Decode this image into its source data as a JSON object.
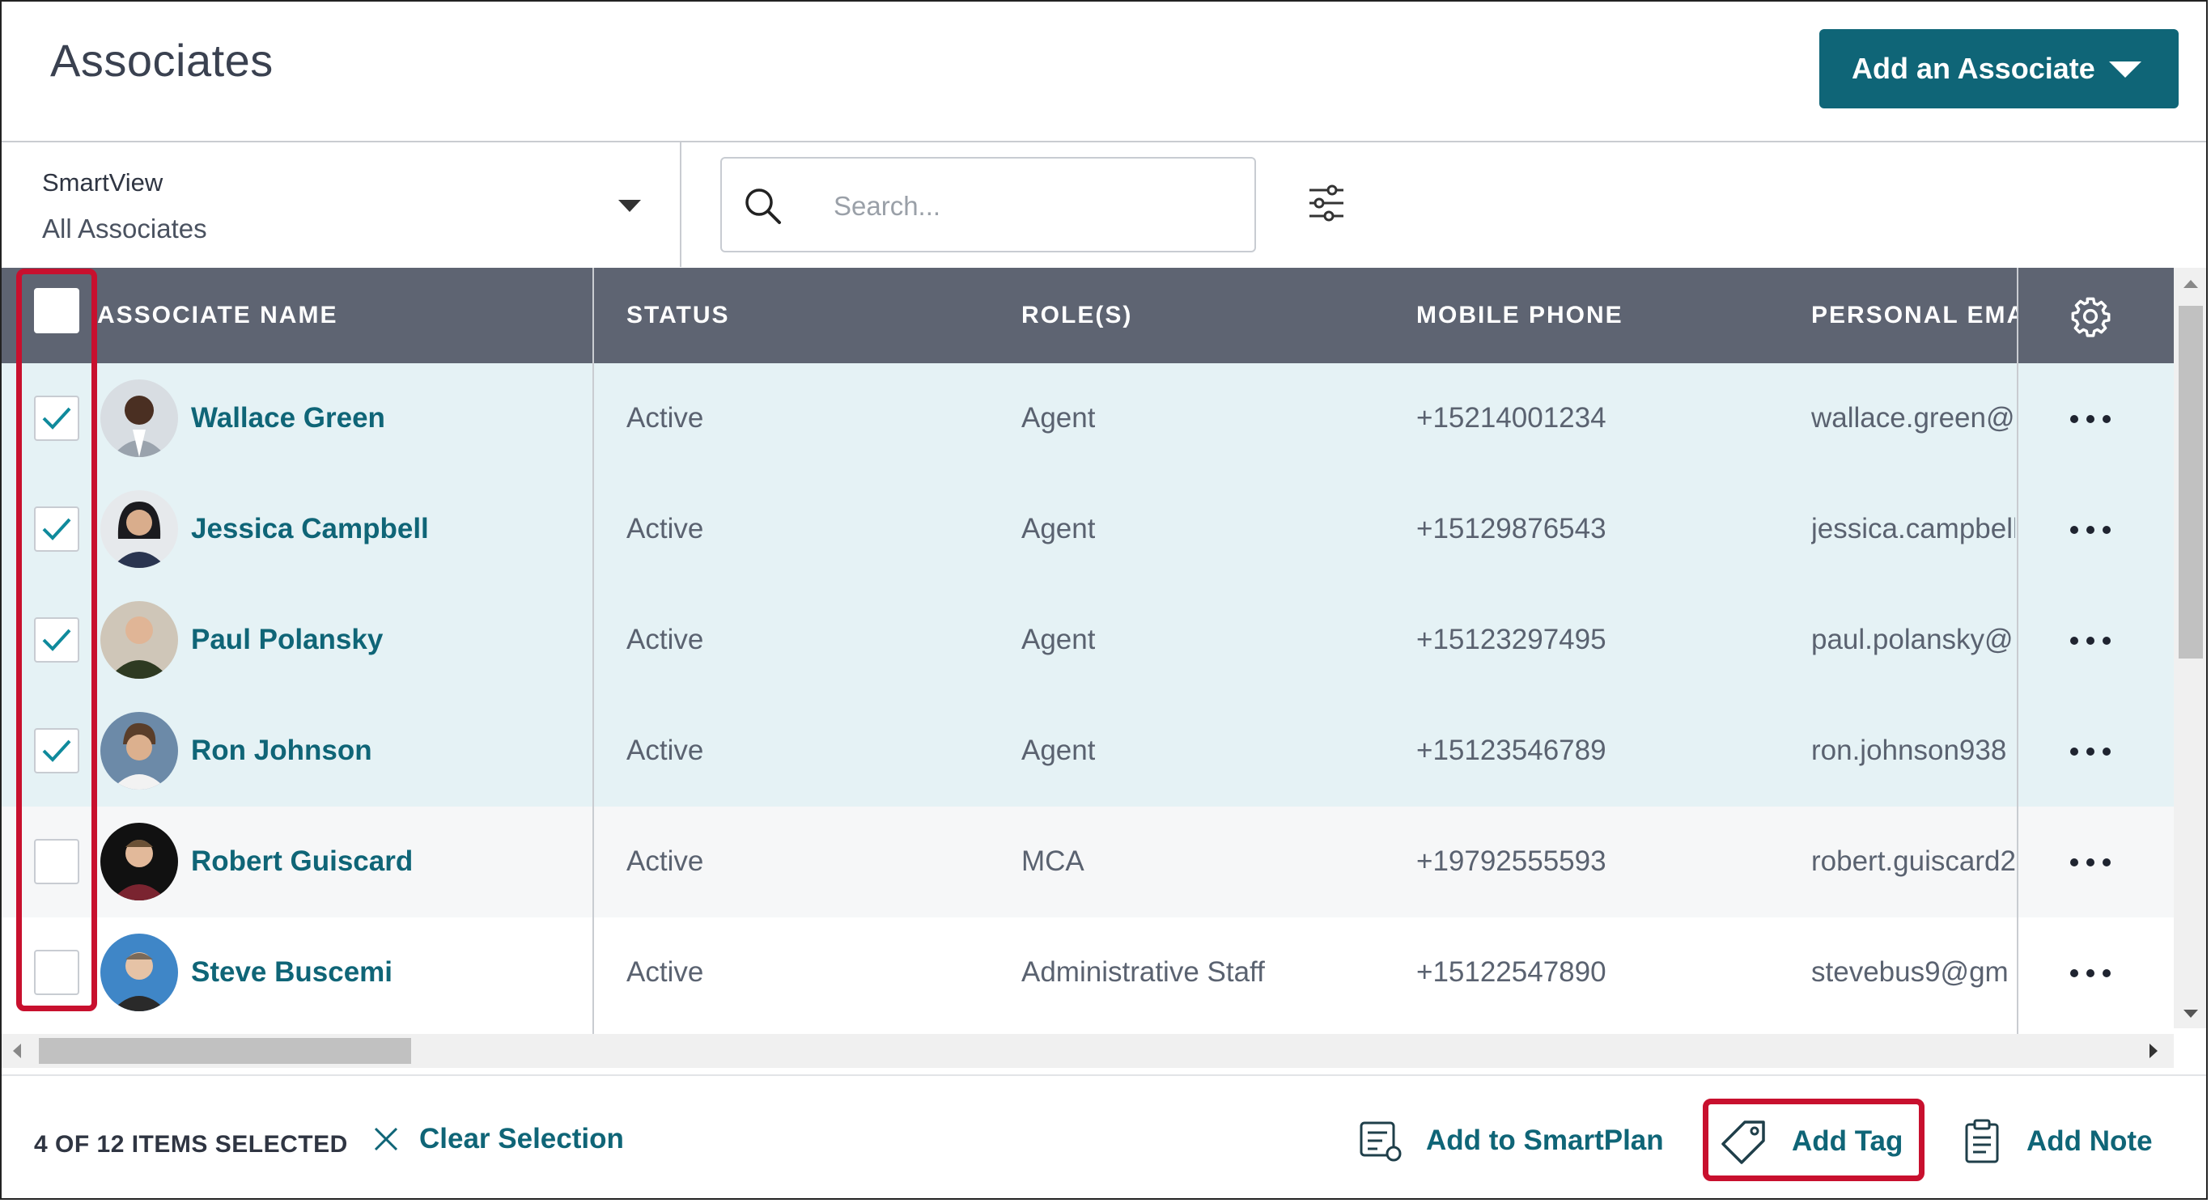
{
  "header": {
    "title": "Associates",
    "add_button_label": "Add an Associate"
  },
  "toolbar": {
    "smartview_label": "SmartView",
    "smartview_value": "All Associates",
    "search_placeholder": "Search..."
  },
  "table": {
    "columns": [
      "ASSOCIATE NAME",
      "STATUS",
      "ROLE(S)",
      "MOBILE PHONE",
      "PERSONAL EMA"
    ],
    "rows": [
      {
        "name": "Wallace Green",
        "status": "Active",
        "role": "Agent",
        "phone": "+15214001234",
        "email": "wallace.green@",
        "selected": true
      },
      {
        "name": "Jessica Campbell",
        "status": "Active",
        "role": "Agent",
        "phone": "+15129876543",
        "email": "jessica.campbell",
        "selected": true
      },
      {
        "name": "Paul Polansky",
        "status": "Active",
        "role": "Agent",
        "phone": "+15123297495",
        "email": "paul.polansky@",
        "selected": true
      },
      {
        "name": "Ron Johnson",
        "status": "Active",
        "role": "Agent",
        "phone": "+15123546789",
        "email": "ron.johnson938",
        "selected": true
      },
      {
        "name": "Robert Guiscard",
        "status": "Active",
        "role": "MCA",
        "phone": "+19792555593",
        "email": "robert.guiscard2",
        "selected": false
      },
      {
        "name": "Steve Buscemi",
        "status": "Active",
        "role": "Administrative Staff",
        "phone": "+15122547890",
        "email": "stevebus9@gm",
        "selected": false
      }
    ]
  },
  "footer": {
    "selection_count": "4 OF 12 ITEMS SELECTED",
    "clear_selection": "Clear Selection",
    "add_to_smartplan": "Add to SmartPlan",
    "add_tag": "Add Tag",
    "add_note": "Add Note"
  },
  "colors": {
    "accent": "#0f6577",
    "header_bg": "#5e6472",
    "selected_row_bg": "#e5f2f5",
    "highlight_red": "#c8102e"
  },
  "icons": [
    "chevron-down-icon",
    "search-icon",
    "filter-sliders-icon",
    "gear-icon",
    "more-options-icon",
    "close-icon",
    "smartplan-icon",
    "tag-icon",
    "note-icon",
    "checkmark-icon"
  ]
}
